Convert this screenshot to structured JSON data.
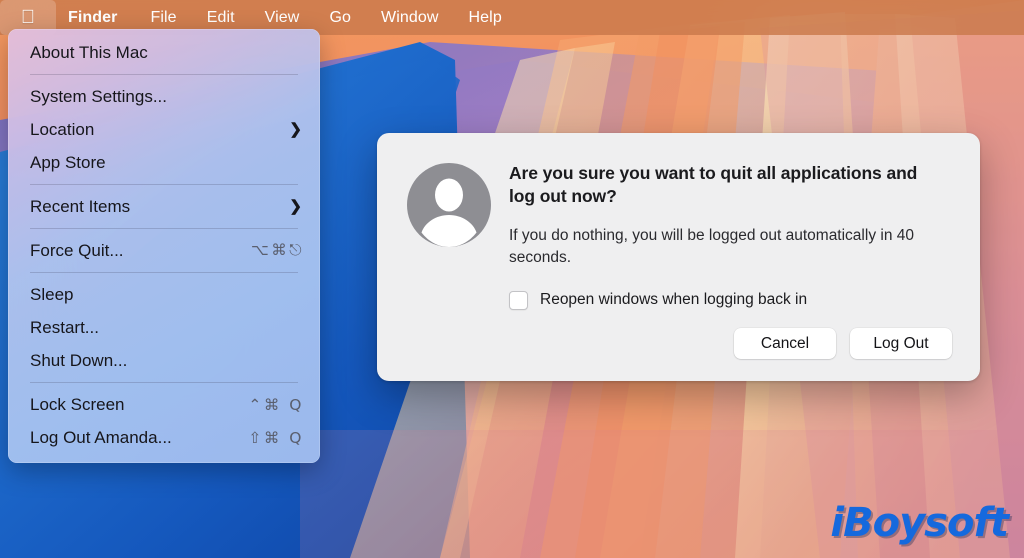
{
  "menubar": {
    "apple_icon": "apple-logo-icon",
    "items": [
      {
        "label": "Finder",
        "bold": true
      },
      {
        "label": "File",
        "bold": false
      },
      {
        "label": "Edit",
        "bold": false
      },
      {
        "label": "View",
        "bold": false
      },
      {
        "label": "Go",
        "bold": false
      },
      {
        "label": "Window",
        "bold": false
      },
      {
        "label": "Help",
        "bold": false
      }
    ]
  },
  "apple_menu": {
    "groups": [
      {
        "items": [
          {
            "label": "About This Mac",
            "shortcut": "",
            "submenu": false
          }
        ]
      },
      {
        "items": [
          {
            "label": "System Settings...",
            "shortcut": "",
            "submenu": false
          },
          {
            "label": "Location",
            "shortcut": "",
            "submenu": true
          },
          {
            "label": "App Store",
            "shortcut": "",
            "submenu": false
          }
        ]
      },
      {
        "items": [
          {
            "label": "Recent Items",
            "shortcut": "",
            "submenu": true
          }
        ]
      },
      {
        "items": [
          {
            "label": "Force Quit...",
            "shortcut": "⌥⌘⎋",
            "submenu": false
          }
        ]
      },
      {
        "items": [
          {
            "label": "Sleep",
            "shortcut": "",
            "submenu": false
          },
          {
            "label": "Restart...",
            "shortcut": "",
            "submenu": false
          },
          {
            "label": "Shut Down...",
            "shortcut": "",
            "submenu": false
          }
        ]
      },
      {
        "items": [
          {
            "label": "Lock Screen",
            "shortcut": "⌃⌘ Q",
            "submenu": false
          },
          {
            "label": "Log Out Amanda...",
            "shortcut": "⇧⌘ Q",
            "submenu": false
          }
        ]
      }
    ]
  },
  "dialog": {
    "avatar_icon": "user-account-icon",
    "title": "Are you sure you want to quit all applications and log out now?",
    "message": "If you do nothing, you will be logged out automatically in 40 seconds.",
    "checkbox": {
      "label": "Reopen windows when logging back in",
      "checked": false
    },
    "buttons": [
      {
        "label": "Cancel",
        "role": "cancel"
      },
      {
        "label": "Log Out",
        "role": "confirm"
      }
    ]
  },
  "watermark": {
    "text": "iBoysoft"
  },
  "colors": {
    "menubar_tint": "#c8784b",
    "menu_panel_top": "#e2bede",
    "menu_panel_bottom": "#a3bff0",
    "dialog_bg": "#efeff0",
    "desktop_blue": "#1565c8",
    "desktop_orange": "#f0945c",
    "desktop_purple": "#9a7cc4",
    "watermark_blue": "#1569dd",
    "avatar_gray": "#8e8e93"
  }
}
